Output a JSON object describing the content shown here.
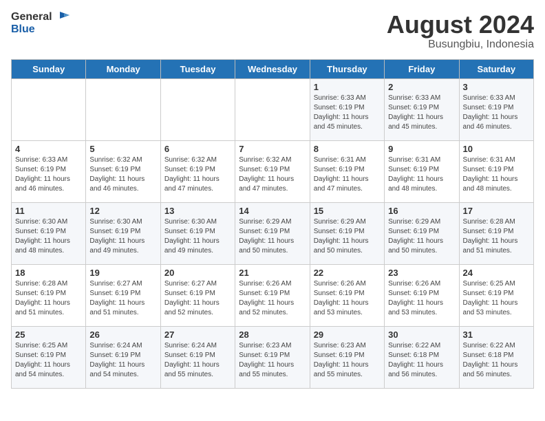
{
  "header": {
    "logo_line1": "General",
    "logo_line2": "Blue",
    "month_year": "August 2024",
    "location": "Busungbiu, Indonesia"
  },
  "weekdays": [
    "Sunday",
    "Monday",
    "Tuesday",
    "Wednesday",
    "Thursday",
    "Friday",
    "Saturday"
  ],
  "weeks": [
    [
      {
        "day": "",
        "info": ""
      },
      {
        "day": "",
        "info": ""
      },
      {
        "day": "",
        "info": ""
      },
      {
        "day": "",
        "info": ""
      },
      {
        "day": "1",
        "info": "Sunrise: 6:33 AM\nSunset: 6:19 PM\nDaylight: 11 hours\nand 45 minutes."
      },
      {
        "day": "2",
        "info": "Sunrise: 6:33 AM\nSunset: 6:19 PM\nDaylight: 11 hours\nand 45 minutes."
      },
      {
        "day": "3",
        "info": "Sunrise: 6:33 AM\nSunset: 6:19 PM\nDaylight: 11 hours\nand 46 minutes."
      }
    ],
    [
      {
        "day": "4",
        "info": "Sunrise: 6:33 AM\nSunset: 6:19 PM\nDaylight: 11 hours\nand 46 minutes."
      },
      {
        "day": "5",
        "info": "Sunrise: 6:32 AM\nSunset: 6:19 PM\nDaylight: 11 hours\nand 46 minutes."
      },
      {
        "day": "6",
        "info": "Sunrise: 6:32 AM\nSunset: 6:19 PM\nDaylight: 11 hours\nand 47 minutes."
      },
      {
        "day": "7",
        "info": "Sunrise: 6:32 AM\nSunset: 6:19 PM\nDaylight: 11 hours\nand 47 minutes."
      },
      {
        "day": "8",
        "info": "Sunrise: 6:31 AM\nSunset: 6:19 PM\nDaylight: 11 hours\nand 47 minutes."
      },
      {
        "day": "9",
        "info": "Sunrise: 6:31 AM\nSunset: 6:19 PM\nDaylight: 11 hours\nand 48 minutes."
      },
      {
        "day": "10",
        "info": "Sunrise: 6:31 AM\nSunset: 6:19 PM\nDaylight: 11 hours\nand 48 minutes."
      }
    ],
    [
      {
        "day": "11",
        "info": "Sunrise: 6:30 AM\nSunset: 6:19 PM\nDaylight: 11 hours\nand 48 minutes."
      },
      {
        "day": "12",
        "info": "Sunrise: 6:30 AM\nSunset: 6:19 PM\nDaylight: 11 hours\nand 49 minutes."
      },
      {
        "day": "13",
        "info": "Sunrise: 6:30 AM\nSunset: 6:19 PM\nDaylight: 11 hours\nand 49 minutes."
      },
      {
        "day": "14",
        "info": "Sunrise: 6:29 AM\nSunset: 6:19 PM\nDaylight: 11 hours\nand 50 minutes."
      },
      {
        "day": "15",
        "info": "Sunrise: 6:29 AM\nSunset: 6:19 PM\nDaylight: 11 hours\nand 50 minutes."
      },
      {
        "day": "16",
        "info": "Sunrise: 6:29 AM\nSunset: 6:19 PM\nDaylight: 11 hours\nand 50 minutes."
      },
      {
        "day": "17",
        "info": "Sunrise: 6:28 AM\nSunset: 6:19 PM\nDaylight: 11 hours\nand 51 minutes."
      }
    ],
    [
      {
        "day": "18",
        "info": "Sunrise: 6:28 AM\nSunset: 6:19 PM\nDaylight: 11 hours\nand 51 minutes."
      },
      {
        "day": "19",
        "info": "Sunrise: 6:27 AM\nSunset: 6:19 PM\nDaylight: 11 hours\nand 51 minutes."
      },
      {
        "day": "20",
        "info": "Sunrise: 6:27 AM\nSunset: 6:19 PM\nDaylight: 11 hours\nand 52 minutes."
      },
      {
        "day": "21",
        "info": "Sunrise: 6:26 AM\nSunset: 6:19 PM\nDaylight: 11 hours\nand 52 minutes."
      },
      {
        "day": "22",
        "info": "Sunrise: 6:26 AM\nSunset: 6:19 PM\nDaylight: 11 hours\nand 53 minutes."
      },
      {
        "day": "23",
        "info": "Sunrise: 6:26 AM\nSunset: 6:19 PM\nDaylight: 11 hours\nand 53 minutes."
      },
      {
        "day": "24",
        "info": "Sunrise: 6:25 AM\nSunset: 6:19 PM\nDaylight: 11 hours\nand 53 minutes."
      }
    ],
    [
      {
        "day": "25",
        "info": "Sunrise: 6:25 AM\nSunset: 6:19 PM\nDaylight: 11 hours\nand 54 minutes."
      },
      {
        "day": "26",
        "info": "Sunrise: 6:24 AM\nSunset: 6:19 PM\nDaylight: 11 hours\nand 54 minutes."
      },
      {
        "day": "27",
        "info": "Sunrise: 6:24 AM\nSunset: 6:19 PM\nDaylight: 11 hours\nand 55 minutes."
      },
      {
        "day": "28",
        "info": "Sunrise: 6:23 AM\nSunset: 6:19 PM\nDaylight: 11 hours\nand 55 minutes."
      },
      {
        "day": "29",
        "info": "Sunrise: 6:23 AM\nSunset: 6:19 PM\nDaylight: 11 hours\nand 55 minutes."
      },
      {
        "day": "30",
        "info": "Sunrise: 6:22 AM\nSunset: 6:18 PM\nDaylight: 11 hours\nand 56 minutes."
      },
      {
        "day": "31",
        "info": "Sunrise: 6:22 AM\nSunset: 6:18 PM\nDaylight: 11 hours\nand 56 minutes."
      }
    ]
  ]
}
